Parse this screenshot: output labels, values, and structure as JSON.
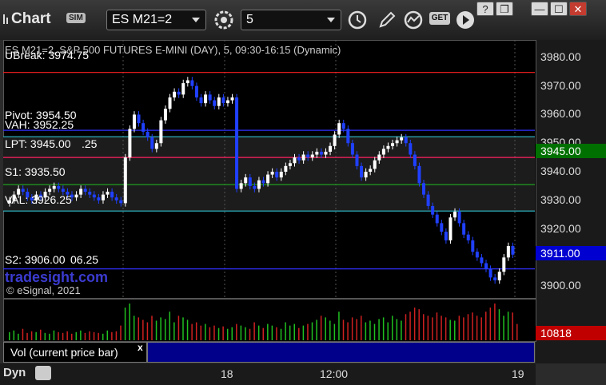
{
  "toolbar": {
    "title": "Chart",
    "sim_badge": "SIM",
    "symbol": "ES M21=2",
    "interval": "5",
    "get_label": "GET"
  },
  "window_controls": {
    "help": "?",
    "restore": "❐",
    "minimize": "—",
    "maximize": "☐",
    "close": "✕"
  },
  "chart_header": {
    "symbol_line": "ES M21=2, S&P 500 FUTURES E-MINI (DAY), 5, 09:30-16:15 (Dynamic)"
  },
  "levels": {
    "ubreak": "UBreak: 3974.75",
    "pivot": "Pivot: 3954.50",
    "vah": "VAH: 3952.25",
    "lpt": "LPT: 3945.00",
    "lpt_suffix": ".25",
    "s1": "S1: 3935.50",
    "val": "VAL: 3926.25",
    "s2": "S2: 3906.00",
    "s2_suffix": "06.25"
  },
  "watermark": "tradesight.com",
  "copyright": "© eSignal, 2021",
  "legend": {
    "vol_label": "Vol (current price bar)",
    "close": "x"
  },
  "bottom": {
    "dyn_label": "Dyn"
  },
  "colors": {
    "ubreak": "#ff2020",
    "pivot": "#3030ff",
    "vah": "#30c0d0",
    "lpt": "#ff2060",
    "s1": "#20a020",
    "val": "#30c0d0",
    "s2": "#3030ff",
    "up_bar": "#ffffff",
    "down_bar": "#2040ff",
    "current_price": "#007000",
    "last_box": "#0000d0",
    "vol_box": "#c00000"
  },
  "chart_data": {
    "type": "candlestick",
    "ylim": [
      3895,
      3985
    ],
    "y_ticks": [
      "3980.00",
      "3970.00",
      "3960.00",
      "3950.00",
      "3940.00",
      "3930.00",
      "3920.00",
      "3910.00",
      "3900.00"
    ],
    "x_ticks": [
      "18",
      "12:00",
      "19"
    ],
    "price_labels": {
      "current": "3945.00",
      "last": "3911.00",
      "volume": "10818"
    },
    "levels": [
      {
        "name": "UBreak",
        "value": 3974.75
      },
      {
        "name": "Pivot",
        "value": 3954.5
      },
      {
        "name": "VAH",
        "value": 3952.25
      },
      {
        "name": "LPT",
        "value": 3945.0
      },
      {
        "name": "S1",
        "value": 3935.5
      },
      {
        "name": "VAL",
        "value": 3926.25
      },
      {
        "name": "S2",
        "value": 3906.0
      }
    ],
    "closes": [
      3930,
      3932,
      3934,
      3933,
      3931,
      3930,
      3932,
      3931,
      3933,
      3934,
      3935,
      3934,
      3933,
      3932,
      3931,
      3932,
      3934,
      3933,
      3932,
      3931,
      3930,
      3932,
      3933,
      3931,
      3930,
      3929,
      3945,
      3955,
      3960,
      3957,
      3954,
      3952,
      3948,
      3950,
      3958,
      3962,
      3966,
      3968,
      3967,
      3971,
      3972,
      3970,
      3966,
      3964,
      3967,
      3965,
      3963,
      3966,
      3964,
      3965,
      3966,
      3934,
      3936,
      3938,
      3935,
      3934,
      3937,
      3936,
      3939,
      3940,
      3938,
      3940,
      3942,
      3943,
      3945,
      3944,
      3946,
      3945,
      3946,
      3947,
      3946,
      3947,
      3949,
      3953,
      3957,
      3955,
      3950,
      3946,
      3942,
      3938,
      3940,
      3941,
      3944,
      3946,
      3948,
      3949,
      3950,
      3951,
      3952,
      3950,
      3946,
      3942,
      3936,
      3932,
      3928,
      3925,
      3922,
      3919,
      3916,
      3924,
      3926,
      3922,
      3918,
      3916,
      3912,
      3910,
      3908,
      3906,
      3903,
      3902,
      3905,
      3910,
      3914,
      3911
    ],
    "volumes": [
      10,
      12,
      8,
      14,
      9,
      11,
      10,
      13,
      9,
      8,
      12,
      10,
      9,
      11,
      8,
      10,
      12,
      9,
      11,
      10,
      9,
      8,
      12,
      10,
      11,
      18,
      40,
      45,
      30,
      28,
      25,
      22,
      30,
      24,
      28,
      26,
      35,
      22,
      30,
      28,
      25,
      20,
      22,
      18,
      20,
      16,
      18,
      15,
      17,
      14,
      16,
      20,
      18,
      16,
      14,
      22,
      18,
      15,
      20,
      18,
      16,
      14,
      22,
      18,
      20,
      15,
      18,
      20,
      22,
      25,
      30,
      28,
      24,
      20,
      35,
      25,
      22,
      28,
      26,
      30,
      22,
      24,
      20,
      26,
      28,
      22,
      30,
      26,
      24,
      32,
      35,
      40,
      38,
      32,
      30,
      28,
      34,
      30,
      28,
      25,
      24,
      30,
      28,
      32,
      34,
      30,
      28,
      35,
      40,
      45,
      38,
      30,
      35,
      34,
      20
    ]
  }
}
